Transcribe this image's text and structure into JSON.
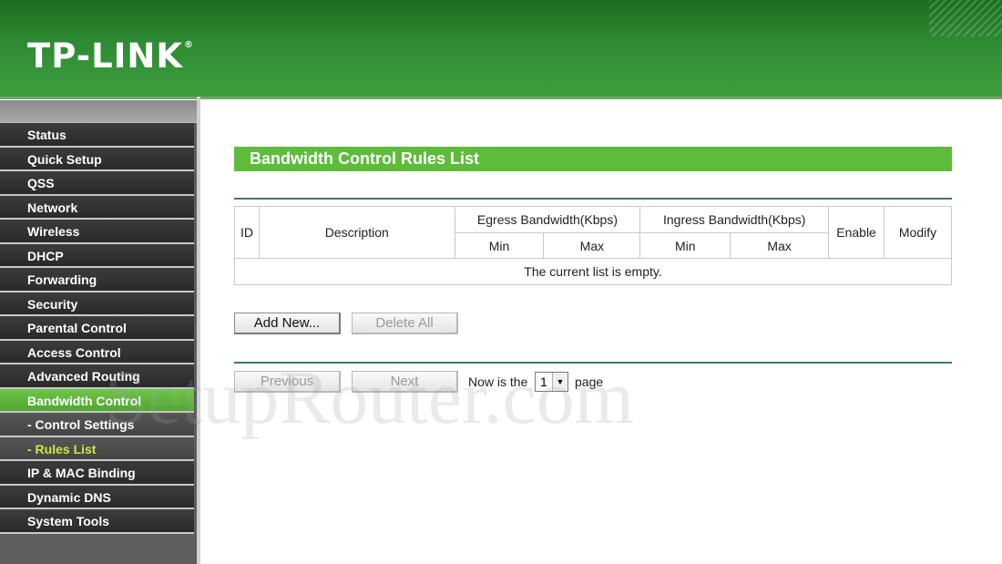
{
  "brand": {
    "logo": "TP-LINK",
    "registered": "®"
  },
  "sidebar": {
    "items": [
      {
        "label": "Status"
      },
      {
        "label": "Quick Setup"
      },
      {
        "label": "QSS"
      },
      {
        "label": "Network"
      },
      {
        "label": "Wireless"
      },
      {
        "label": "DHCP"
      },
      {
        "label": "Forwarding"
      },
      {
        "label": "Security"
      },
      {
        "label": "Parental Control"
      },
      {
        "label": "Access Control"
      },
      {
        "label": "Advanced Routing"
      },
      {
        "label": "Bandwidth Control"
      },
      {
        "label": "- Control Settings"
      },
      {
        "label": "- Rules List"
      },
      {
        "label": "IP & MAC Binding"
      },
      {
        "label": "Dynamic DNS"
      },
      {
        "label": "System Tools"
      }
    ]
  },
  "main": {
    "title": "Bandwidth Control Rules List",
    "table": {
      "col_id": "ID",
      "col_description": "Description",
      "col_egress": "Egress Bandwidth(Kbps)",
      "col_ingress": "Ingress Bandwidth(Kbps)",
      "col_enable": "Enable",
      "col_modify": "Modify",
      "col_min": "Min",
      "col_max": "Max",
      "empty_message": "The current list is empty."
    },
    "buttons": {
      "add_new": "Add New...",
      "delete_all": "Delete All"
    },
    "pager": {
      "previous": "Previous",
      "next": "Next",
      "prefix": "Now is the",
      "current_page": "1",
      "suffix": "page"
    }
  },
  "watermark": "SetupRouter.com",
  "colors": {
    "header_green": "#2e8b34",
    "title_green": "#5dbd3a",
    "active_green": "#5fb53d",
    "sub_active_text": "#c7ea3f"
  }
}
